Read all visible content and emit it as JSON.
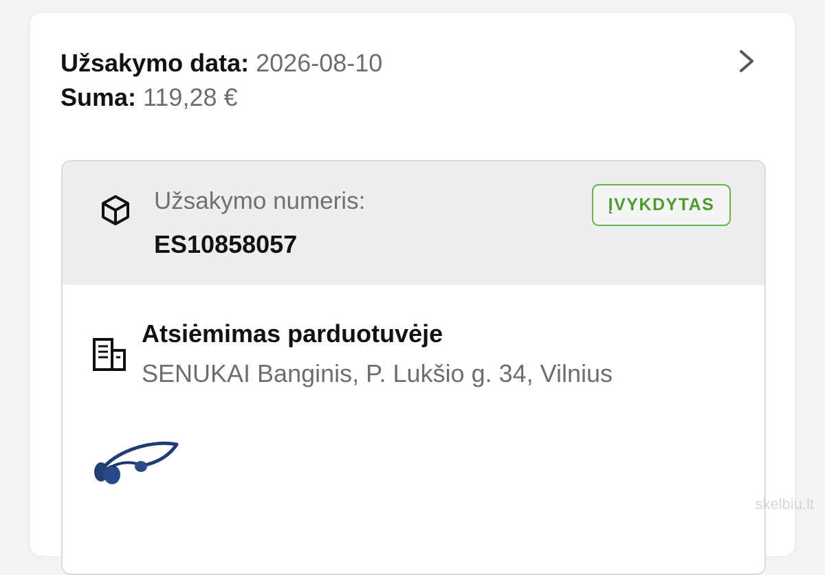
{
  "summary": {
    "date_label": "Užsakymo data:",
    "date_value": "2026-08-10",
    "sum_label": "Suma:",
    "sum_value": "119,28 €",
    "chevron_icon": "chevron-right-icon"
  },
  "order": {
    "icon": "package-box-icon",
    "number_label": "Užsakymo numeris:",
    "number_value": "ES10858057",
    "status": "ĮVYKDYTAS",
    "status_color": "#5aa83b"
  },
  "pickup": {
    "icon": "building-icon",
    "title": "Atsiėmimas parduotuvėje",
    "address": "SENUKAI Banginis, P. Lukšio g. 34, Vilnius"
  },
  "product": {
    "icon": "headphones-image"
  },
  "watermark": {
    "text": "skelbiu.lt"
  }
}
